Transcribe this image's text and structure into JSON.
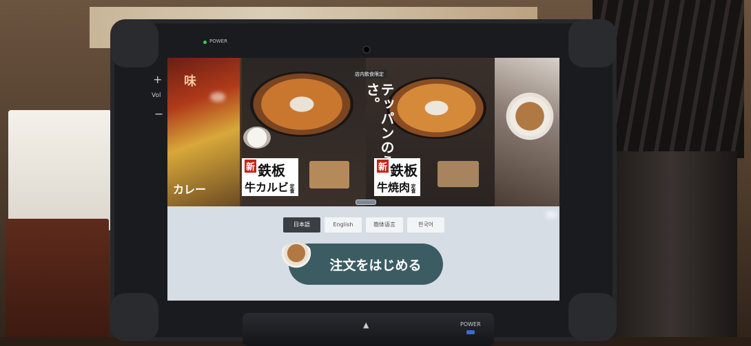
{
  "device": {
    "power_label_top": "POWER",
    "vol_plus": "+",
    "vol_label": "Vol",
    "vol_minus": "−",
    "dock_arrow": "▲",
    "power_label_bottom": "POWER",
    "power_led_color": "#2fd45a"
  },
  "banner": {
    "side_left_taste": "味",
    "side_left_curry": "カレー",
    "limited_tag": "店内飲食限定",
    "vertical_copy": "テッパンのうまさ。",
    "menu_items": [
      {
        "new_badge": "新",
        "name_top": "鉄板",
        "name_bottom": "牛カルビ",
        "suffix": "定食"
      },
      {
        "new_badge": "新",
        "name_top": "鉄板",
        "name_bottom": "牛焼肉",
        "suffix": "定食"
      }
    ]
  },
  "languages": [
    {
      "label": "日本語",
      "active": true
    },
    {
      "label": "English",
      "active": false
    },
    {
      "label": "簡体语言",
      "active": false
    },
    {
      "label": "한국어",
      "active": false
    }
  ],
  "start_button": {
    "label": "注文をはじめる"
  },
  "colors": {
    "start_button": "#3c5c63",
    "lang_active": "#3b3e44",
    "screen_bg": "#d6dde4",
    "new_badge": "#c9231b"
  }
}
